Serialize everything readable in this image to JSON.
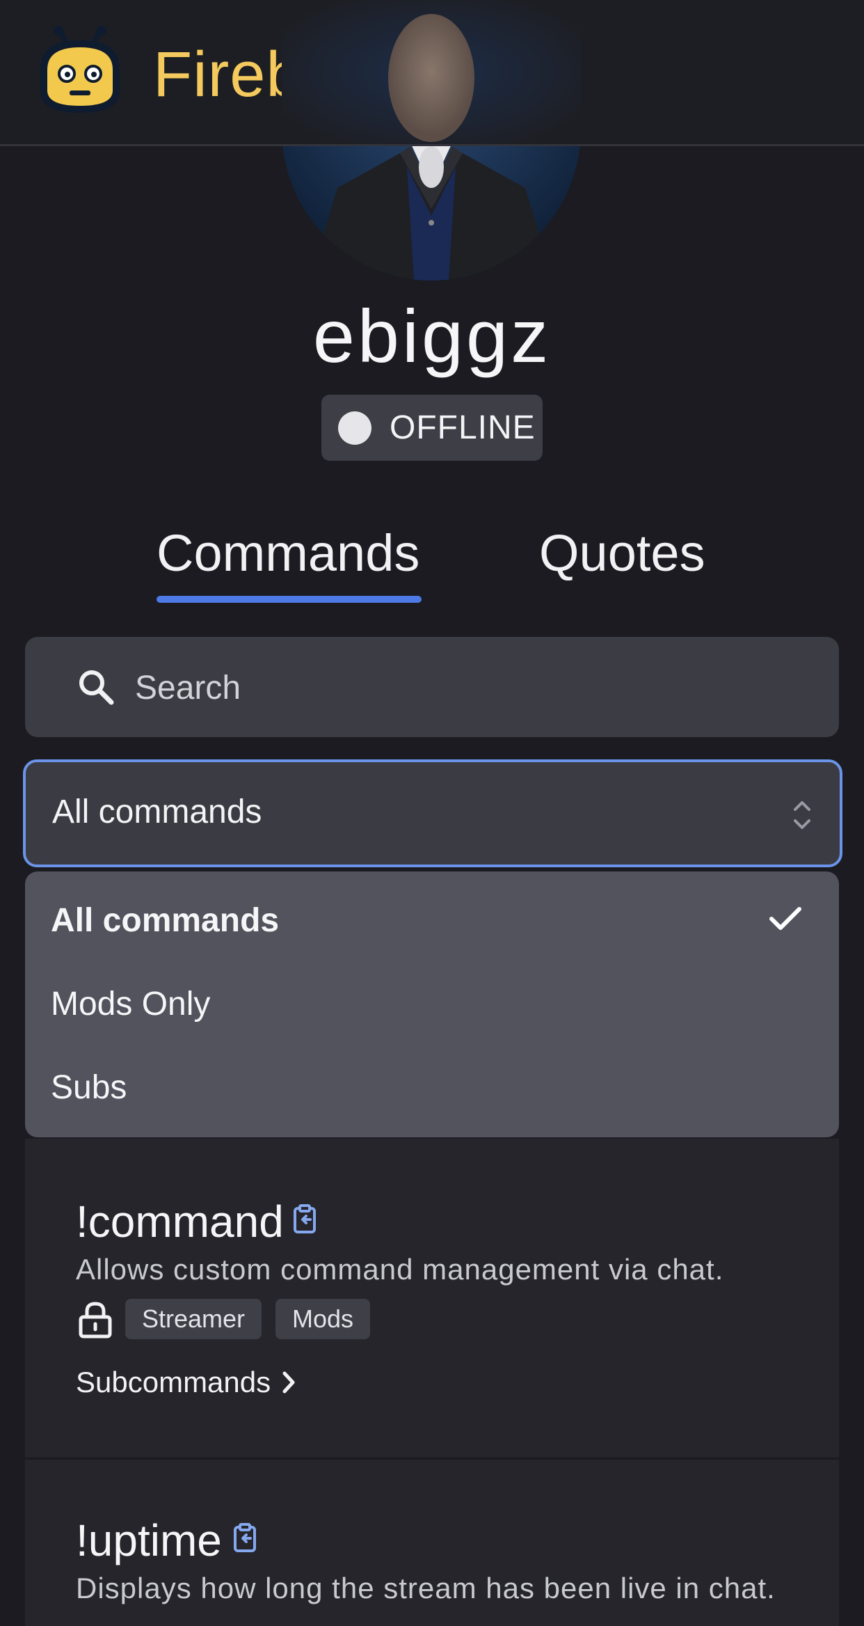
{
  "header": {
    "brand": "Firebot",
    "colors": {
      "brand": "#f4c95d",
      "background": "#1d1e23"
    }
  },
  "profile": {
    "username": "ebiggz",
    "status": "OFFLINE"
  },
  "tabs": [
    {
      "label": "Commands",
      "active": true
    },
    {
      "label": "Quotes",
      "active": false
    }
  ],
  "search": {
    "placeholder": "Search",
    "value": ""
  },
  "filter": {
    "selected": "All commands",
    "options": [
      {
        "label": "All commands",
        "selected": true
      },
      {
        "label": "Mods Only",
        "selected": false
      },
      {
        "label": "Subs",
        "selected": false
      }
    ]
  },
  "commands": [
    {
      "name": "!command",
      "description": "Allows custom command management via chat.",
      "roles": [
        "Streamer",
        "Mods"
      ],
      "subcommands_label": "Subcommands"
    },
    {
      "name": "!uptime",
      "description": "Displays how long the stream has been live in chat."
    }
  ],
  "colors": {
    "accent": "#4d7ae6",
    "page_background": "#1b1b21",
    "dropdown_background": "#52535d"
  }
}
